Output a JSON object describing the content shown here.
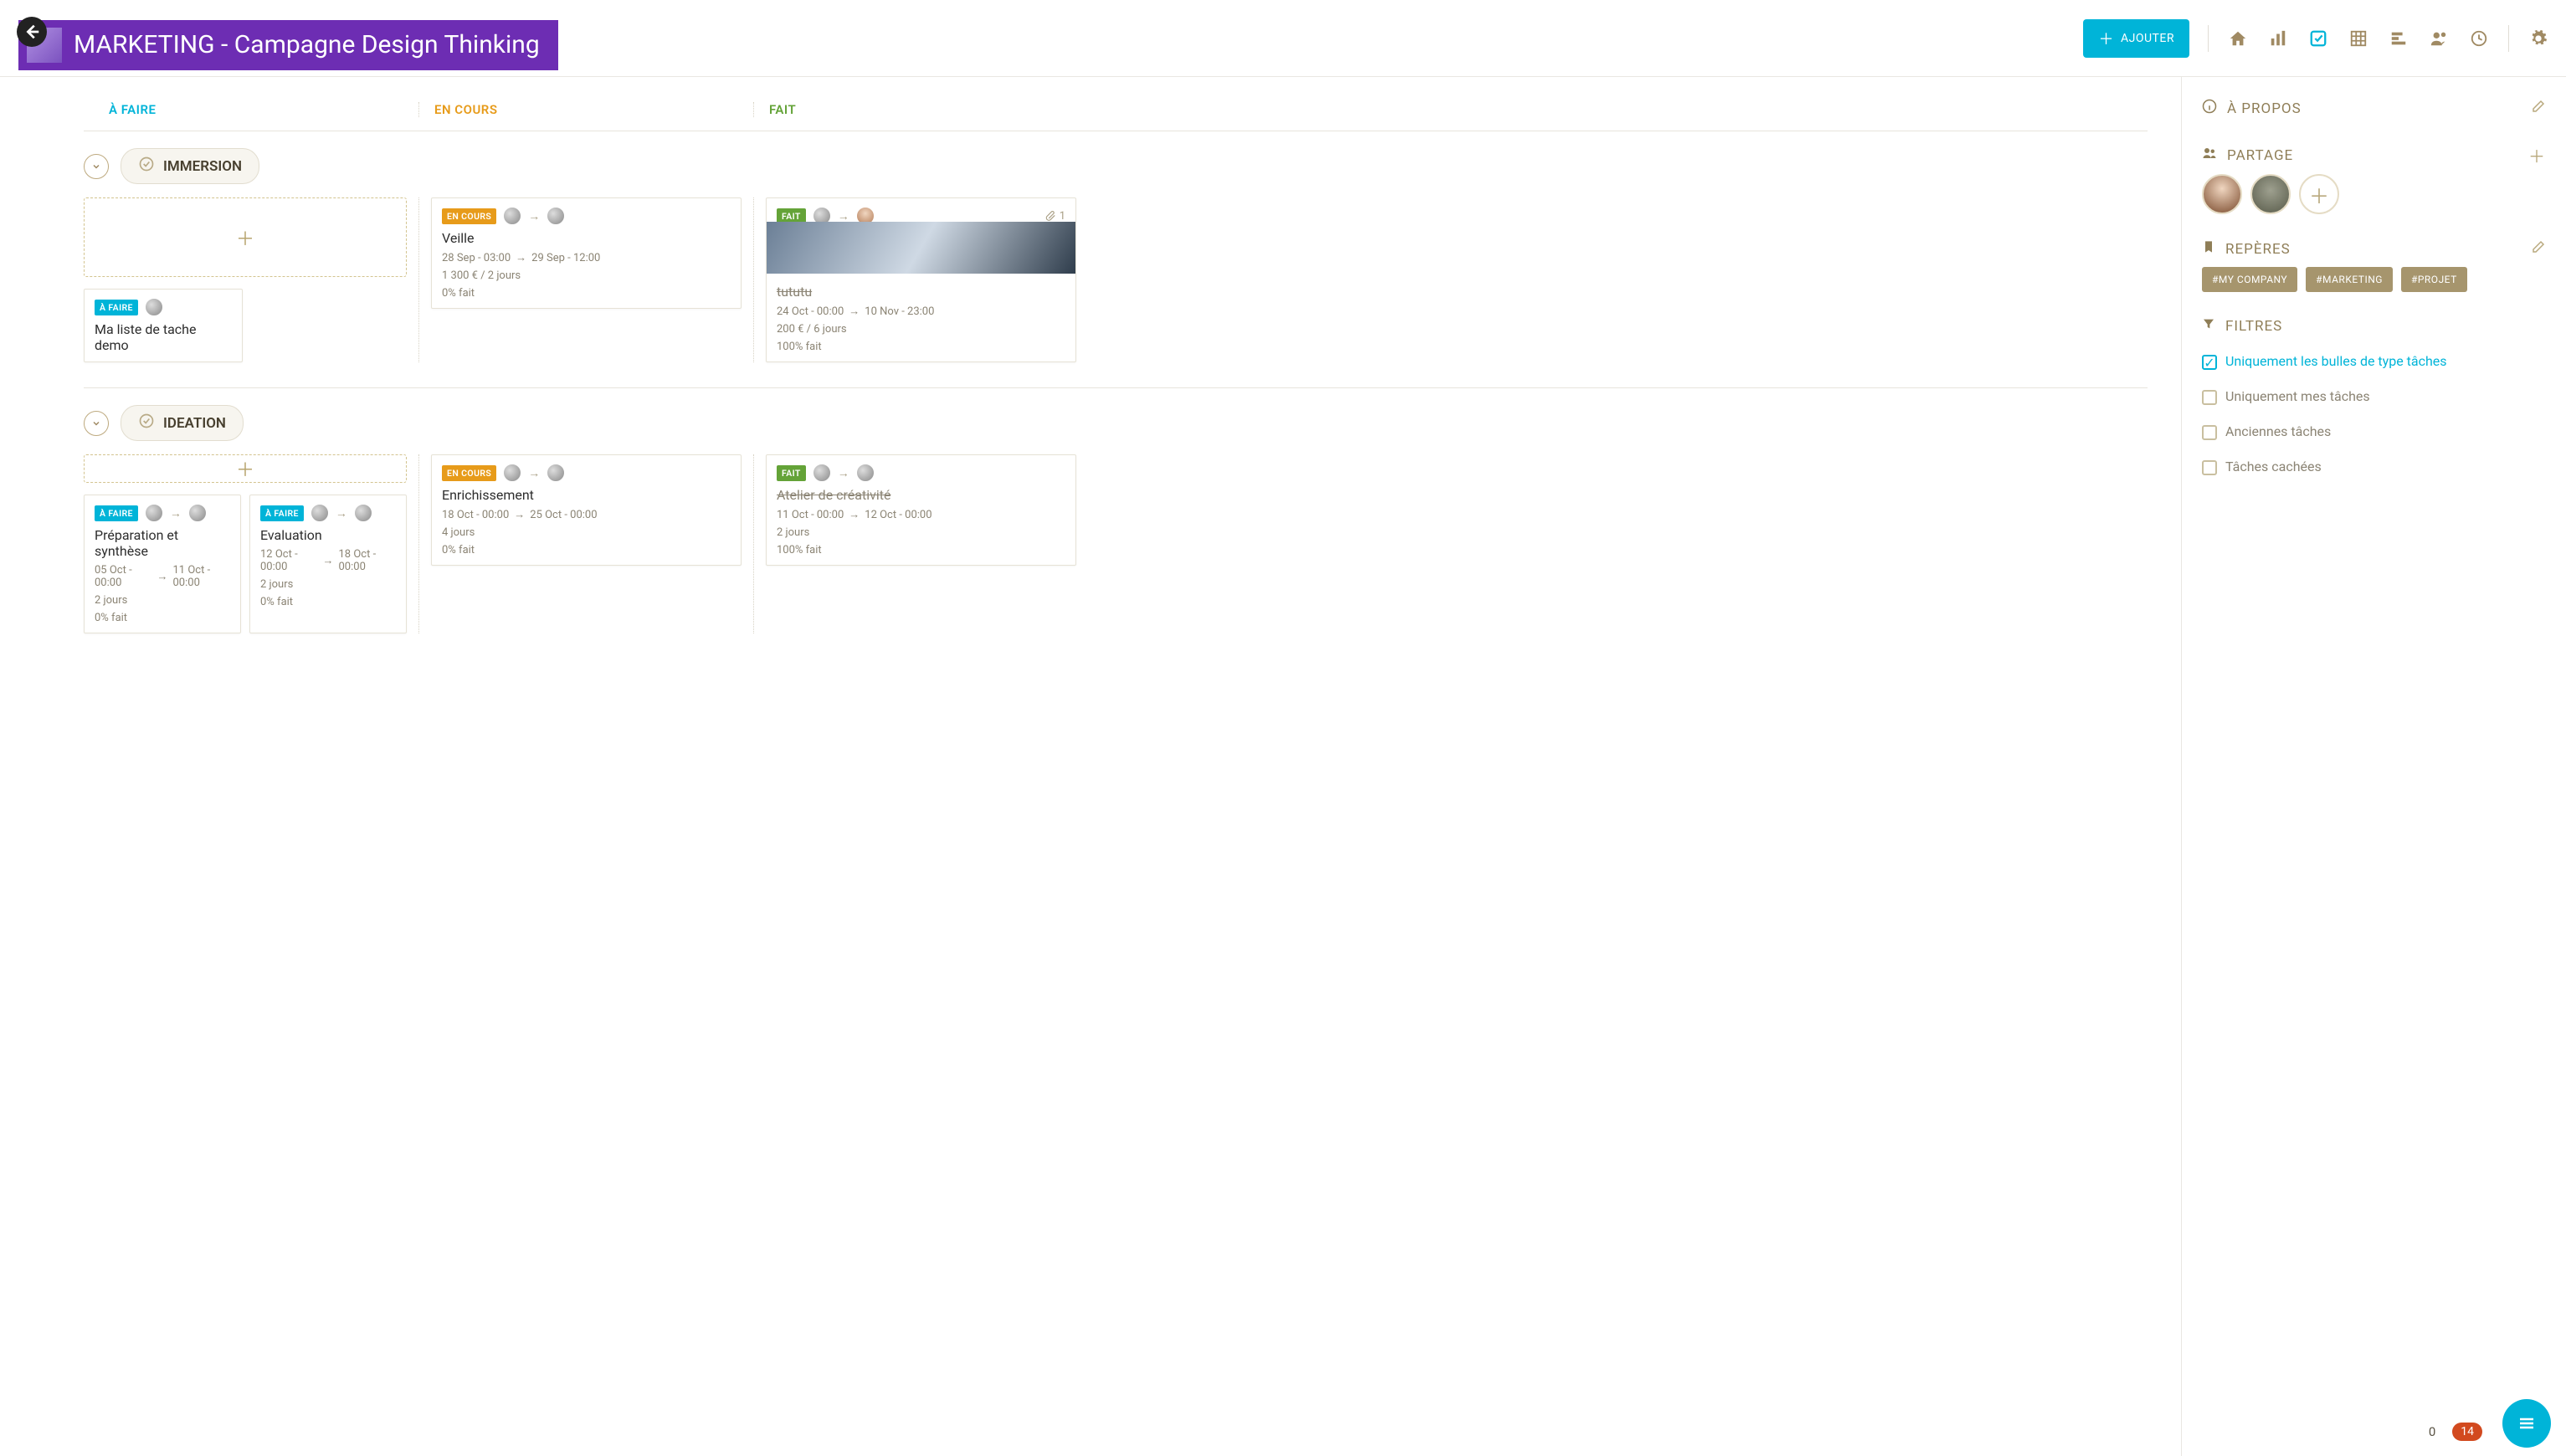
{
  "header": {
    "project_title": "MARKETING - Campagne Design Thinking",
    "add_button": "AJOUTER"
  },
  "columns": {
    "todo": "À FAIRE",
    "doing": "EN COURS",
    "done": "FAIT"
  },
  "lanes": [
    {
      "name": "IMMERSION",
      "todo": [
        {
          "status": "À FAIRE",
          "title": "Ma liste de tache demo"
        }
      ],
      "doing": [
        {
          "status": "EN COURS",
          "title": "Veille",
          "date_from": "28 Sep - 03:00",
          "date_to": "29 Sep - 12:00",
          "cost": "1 300 € / 2 jours",
          "progress": "0% fait"
        }
      ],
      "done": [
        {
          "status": "FAIT",
          "title": "tututu",
          "attachments": "1",
          "has_image": true,
          "date_from": "24 Oct - 00:00",
          "date_to": "10 Nov - 23:00",
          "cost": "200 € / 6 jours",
          "progress": "100% fait"
        }
      ]
    },
    {
      "name": "IDEATION",
      "todo": [
        {
          "status": "À FAIRE",
          "title": "Préparation et synthèse",
          "date_from": "05 Oct - 00:00",
          "date_to": "11 Oct - 00:00",
          "duration": "2 jours",
          "progress": "0% fait"
        },
        {
          "status": "À FAIRE",
          "title": "Evaluation",
          "date_from": "12 Oct - 00:00",
          "date_to": "18 Oct - 00:00",
          "duration": "2 jours",
          "progress": "0% fait"
        }
      ],
      "doing": [
        {
          "status": "EN COURS",
          "title": "Enrichissement",
          "date_from": "18 Oct - 00:00",
          "date_to": "25 Oct - 00:00",
          "duration": "4 jours",
          "progress": "0% fait"
        }
      ],
      "done": [
        {
          "status": "FAIT",
          "title": "Atelier de créativité",
          "date_from": "11 Oct - 00:00",
          "date_to": "12 Oct - 00:00",
          "duration": "2 jours",
          "progress": "100% fait"
        }
      ]
    }
  ],
  "right": {
    "about": "À PROPOS",
    "share": "PARTAGE",
    "bookmarks": "REPÈRES",
    "tags": [
      "#MY COMPANY",
      "#MARKETING",
      "#PROJET"
    ],
    "filters_title": "FILTRES",
    "filters": [
      {
        "label": "Uniquement les bulles de type tâches",
        "checked": true
      },
      {
        "label": "Uniquement mes tâches",
        "checked": false
      },
      {
        "label": "Anciennes tâches",
        "checked": false
      },
      {
        "label": "Tâches cachées",
        "checked": false
      }
    ],
    "count_zero": "0",
    "count_badge": "14"
  }
}
